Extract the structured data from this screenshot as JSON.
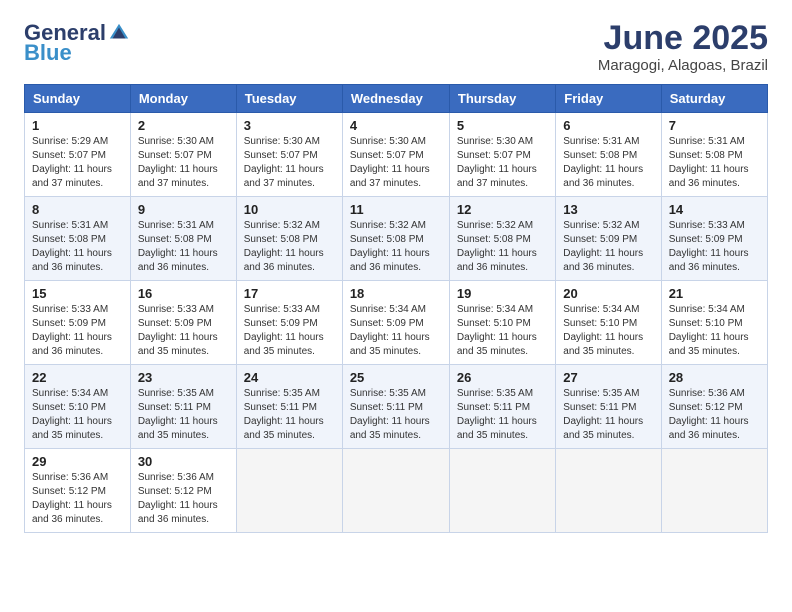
{
  "logo": {
    "general": "General",
    "blue": "Blue"
  },
  "title": {
    "month": "June 2025",
    "location": "Maragogi, Alagoas, Brazil"
  },
  "headers": [
    "Sunday",
    "Monday",
    "Tuesday",
    "Wednesday",
    "Thursday",
    "Friday",
    "Saturday"
  ],
  "weeks": [
    [
      {
        "day": "1",
        "sunrise": "5:29 AM",
        "sunset": "5:07 PM",
        "daylight": "11 hours and 37 minutes."
      },
      {
        "day": "2",
        "sunrise": "5:30 AM",
        "sunset": "5:07 PM",
        "daylight": "11 hours and 37 minutes."
      },
      {
        "day": "3",
        "sunrise": "5:30 AM",
        "sunset": "5:07 PM",
        "daylight": "11 hours and 37 minutes."
      },
      {
        "day": "4",
        "sunrise": "5:30 AM",
        "sunset": "5:07 PM",
        "daylight": "11 hours and 37 minutes."
      },
      {
        "day": "5",
        "sunrise": "5:30 AM",
        "sunset": "5:07 PM",
        "daylight": "11 hours and 37 minutes."
      },
      {
        "day": "6",
        "sunrise": "5:31 AM",
        "sunset": "5:08 PM",
        "daylight": "11 hours and 36 minutes."
      },
      {
        "day": "7",
        "sunrise": "5:31 AM",
        "sunset": "5:08 PM",
        "daylight": "11 hours and 36 minutes."
      }
    ],
    [
      {
        "day": "8",
        "sunrise": "5:31 AM",
        "sunset": "5:08 PM",
        "daylight": "11 hours and 36 minutes."
      },
      {
        "day": "9",
        "sunrise": "5:31 AM",
        "sunset": "5:08 PM",
        "daylight": "11 hours and 36 minutes."
      },
      {
        "day": "10",
        "sunrise": "5:32 AM",
        "sunset": "5:08 PM",
        "daylight": "11 hours and 36 minutes."
      },
      {
        "day": "11",
        "sunrise": "5:32 AM",
        "sunset": "5:08 PM",
        "daylight": "11 hours and 36 minutes."
      },
      {
        "day": "12",
        "sunrise": "5:32 AM",
        "sunset": "5:08 PM",
        "daylight": "11 hours and 36 minutes."
      },
      {
        "day": "13",
        "sunrise": "5:32 AM",
        "sunset": "5:09 PM",
        "daylight": "11 hours and 36 minutes."
      },
      {
        "day": "14",
        "sunrise": "5:33 AM",
        "sunset": "5:09 PM",
        "daylight": "11 hours and 36 minutes."
      }
    ],
    [
      {
        "day": "15",
        "sunrise": "5:33 AM",
        "sunset": "5:09 PM",
        "daylight": "11 hours and 36 minutes."
      },
      {
        "day": "16",
        "sunrise": "5:33 AM",
        "sunset": "5:09 PM",
        "daylight": "11 hours and 35 minutes."
      },
      {
        "day": "17",
        "sunrise": "5:33 AM",
        "sunset": "5:09 PM",
        "daylight": "11 hours and 35 minutes."
      },
      {
        "day": "18",
        "sunrise": "5:34 AM",
        "sunset": "5:09 PM",
        "daylight": "11 hours and 35 minutes."
      },
      {
        "day": "19",
        "sunrise": "5:34 AM",
        "sunset": "5:10 PM",
        "daylight": "11 hours and 35 minutes."
      },
      {
        "day": "20",
        "sunrise": "5:34 AM",
        "sunset": "5:10 PM",
        "daylight": "11 hours and 35 minutes."
      },
      {
        "day": "21",
        "sunrise": "5:34 AM",
        "sunset": "5:10 PM",
        "daylight": "11 hours and 35 minutes."
      }
    ],
    [
      {
        "day": "22",
        "sunrise": "5:34 AM",
        "sunset": "5:10 PM",
        "daylight": "11 hours and 35 minutes."
      },
      {
        "day": "23",
        "sunrise": "5:35 AM",
        "sunset": "5:11 PM",
        "daylight": "11 hours and 35 minutes."
      },
      {
        "day": "24",
        "sunrise": "5:35 AM",
        "sunset": "5:11 PM",
        "daylight": "11 hours and 35 minutes."
      },
      {
        "day": "25",
        "sunrise": "5:35 AM",
        "sunset": "5:11 PM",
        "daylight": "11 hours and 35 minutes."
      },
      {
        "day": "26",
        "sunrise": "5:35 AM",
        "sunset": "5:11 PM",
        "daylight": "11 hours and 35 minutes."
      },
      {
        "day": "27",
        "sunrise": "5:35 AM",
        "sunset": "5:11 PM",
        "daylight": "11 hours and 35 minutes."
      },
      {
        "day": "28",
        "sunrise": "5:36 AM",
        "sunset": "5:12 PM",
        "daylight": "11 hours and 36 minutes."
      }
    ],
    [
      {
        "day": "29",
        "sunrise": "5:36 AM",
        "sunset": "5:12 PM",
        "daylight": "11 hours and 36 minutes."
      },
      {
        "day": "30",
        "sunrise": "5:36 AM",
        "sunset": "5:12 PM",
        "daylight": "11 hours and 36 minutes."
      },
      null,
      null,
      null,
      null,
      null
    ]
  ]
}
